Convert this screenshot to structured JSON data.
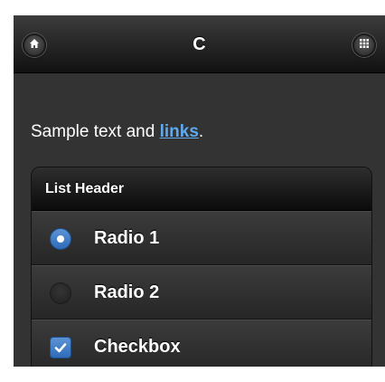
{
  "header": {
    "title": "C",
    "home_icon": "home-icon",
    "grid_icon": "grid-icon"
  },
  "content": {
    "text": "Sample text and ",
    "link": "links",
    "after": "."
  },
  "list": {
    "header": "List Header",
    "items": [
      {
        "label": "Radio 1",
        "type": "radio",
        "checked": true
      },
      {
        "label": "Radio 2",
        "type": "radio",
        "checked": false
      },
      {
        "label": "Checkbox",
        "type": "checkbox",
        "checked": true
      }
    ]
  },
  "colors": {
    "accent": "#3b7bcb",
    "link": "#5fa9ee",
    "background": "#333333"
  }
}
